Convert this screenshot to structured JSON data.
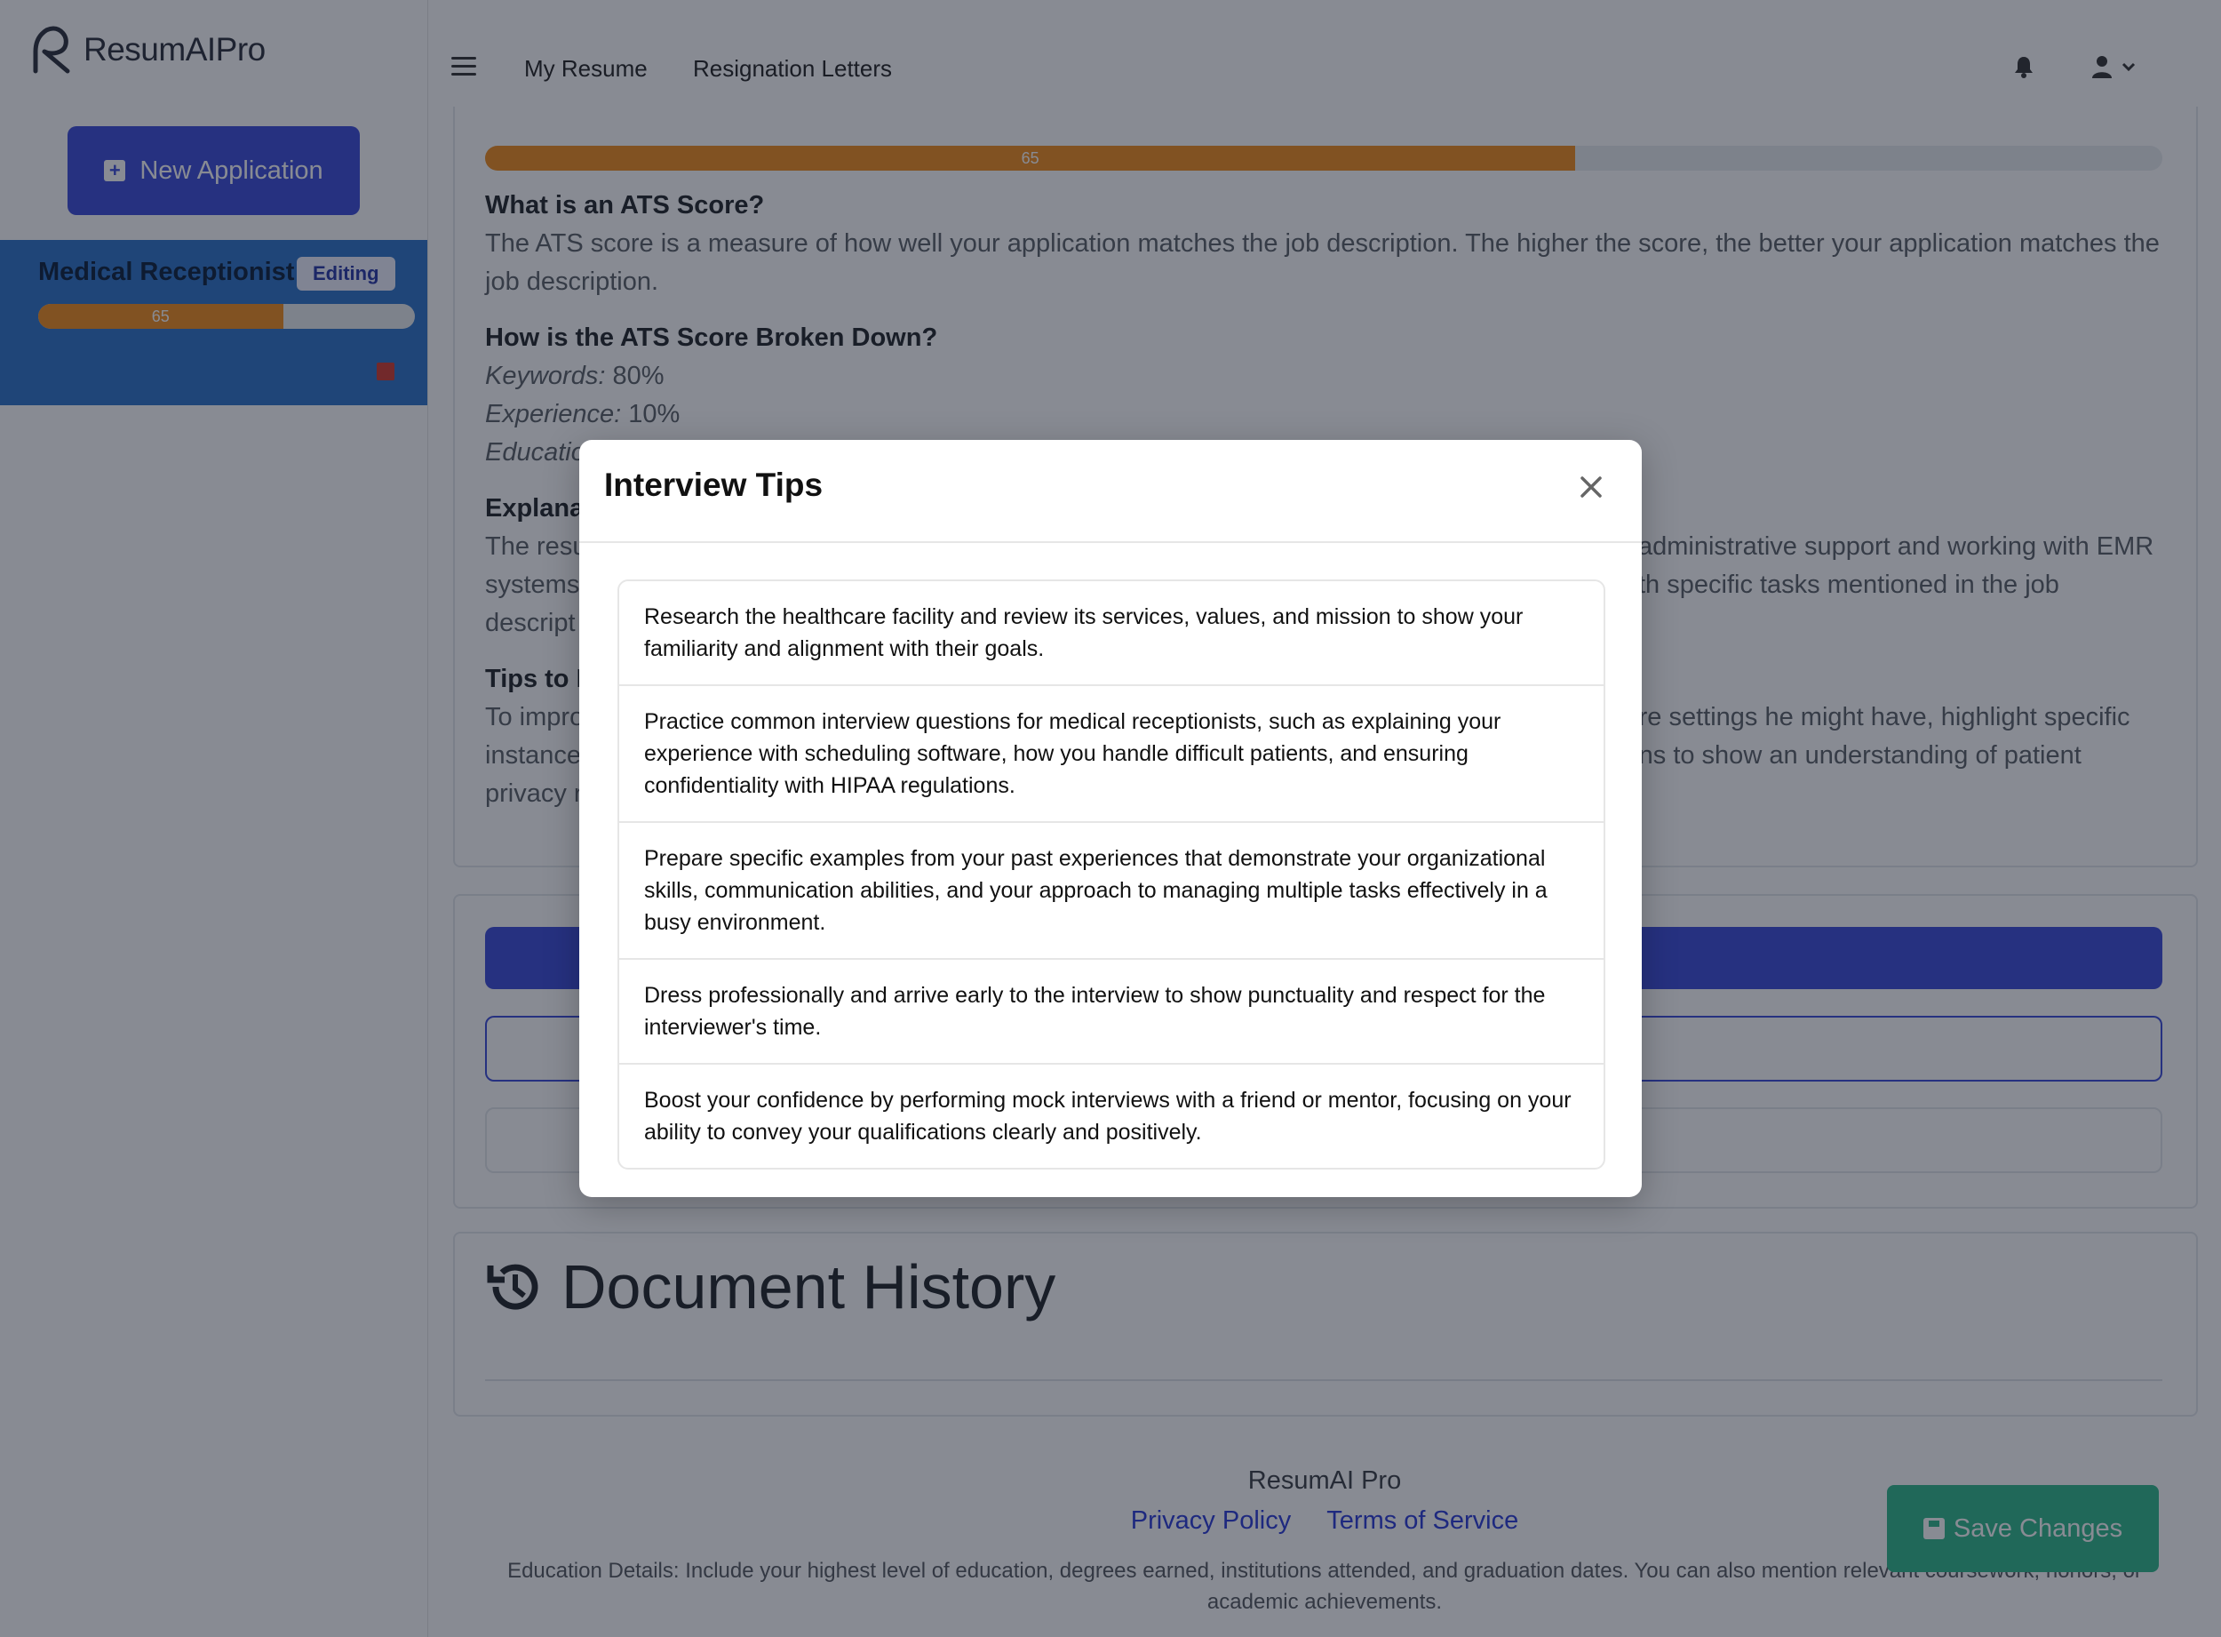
{
  "sidebar": {
    "brand": "ResumAIPro",
    "new_application_label": "New Application",
    "application": {
      "title": "Medical Receptionist",
      "status": "Editing",
      "score": 65,
      "score_label": "65"
    }
  },
  "nav": {
    "links": [
      "My Resume",
      "Resignation Letters"
    ]
  },
  "ats": {
    "score": 65,
    "score_label": "65",
    "what_heading": "What is an ATS Score?",
    "what_text": "The ATS score is a measure of how well your application matches the job description. The higher the score, the better your application matches the job description.",
    "breakdown_heading": "How is the ATS Score Broken Down?",
    "breakdown": [
      {
        "label": "Keywords:",
        "value": "80%"
      },
      {
        "label": "Experience:",
        "value": "10%"
      },
      {
        "label": "Educatio",
        "value": ""
      }
    ],
    "explanation_heading": "Explana",
    "explanation_text_left": "The resu\nsystems\ndescript",
    "explanation_text_right": "administrative support and working with EMR\nth specific tasks mentioned in the job",
    "tips_heading": "Tips to I",
    "tips_text_left": "To impro\ninstance\nprivacy r",
    "tips_text_right": "care settings he might have, highlight specific\ntions to show an understanding of patient"
  },
  "history": {
    "title": "Document History"
  },
  "footer": {
    "brand": "ResumAI Pro",
    "privacy": "Privacy Policy",
    "terms": "Terms of Service",
    "note": "Education Details: Include your highest level of education, degrees earned, institutions attended, and graduation dates. You can also mention relevant coursework, honors, or academic achievements."
  },
  "save_button_label": "Save Changes",
  "modal": {
    "title": "Interview Tips",
    "tips": [
      "Research the healthcare facility and review its services, values, and mission to show your familiarity and alignment with their goals.",
      "Practice common interview questions for medical receptionists, such as explaining your experience with scheduling software, how you handle difficult patients, and ensuring confidentiality with HIPAA regulations.",
      "Prepare specific examples from your past experiences that demonstrate your organizational skills, communication abilities, and your approach to managing multiple tasks effectively in a busy environment.",
      "Dress professionally and arrive early to the interview to show punctuality and respect for the interviewer's time.",
      "Boost your confidence by performing mock interviews with a friend or mentor, focusing on your ability to convey your qualifications clearly and positively."
    ]
  },
  "colors": {
    "accent": "#3b4bd8",
    "progress": "#f08d1d",
    "card": "#2d73c8",
    "save": "#2eb98a"
  }
}
